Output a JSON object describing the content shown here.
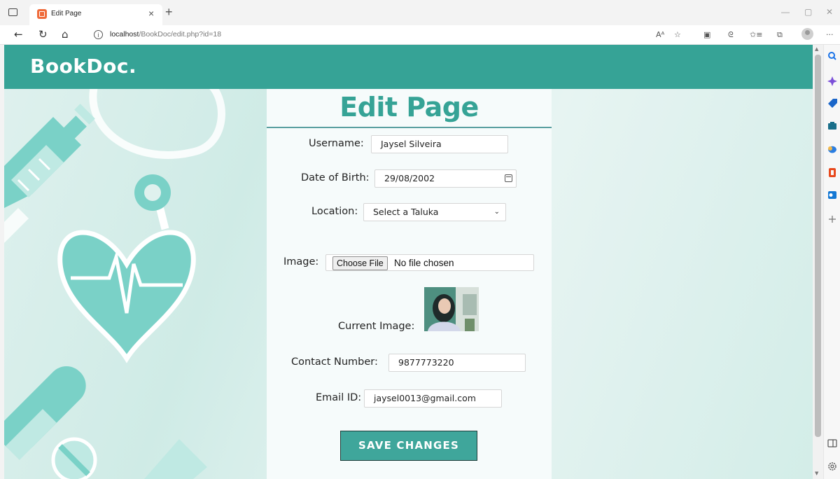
{
  "browser": {
    "tab_title": "Edit Page",
    "tab_close": "×",
    "new_tab": "+",
    "window_controls": {
      "minimize": "—",
      "restore": "▢",
      "close": "✕"
    },
    "url_host": "localhost",
    "url_path": "/BookDoc/edit.php?id=18",
    "nav": {
      "back": "←",
      "reload": "↻",
      "home": "⌂"
    },
    "toolbar_icons": [
      "read-aloud-icon",
      "favorite-add-icon",
      "extensions-icon",
      "refresh-icon",
      "favorites-icon",
      "collections-icon",
      "profile-icon",
      "more-icon"
    ],
    "toolbar_glyphs": {
      "read_aloud": "Aᴬ",
      "favorite_add": "☆",
      "extensions": "▣",
      "copilot": "ᘓ",
      "favorites": "✩≡",
      "collections": "⧉",
      "more": "···"
    }
  },
  "site": {
    "brand": "BookDoc."
  },
  "form": {
    "title": "Edit Page",
    "username": {
      "label": "Username:",
      "value": "Jaysel Silveira"
    },
    "dob": {
      "label": "Date of Birth:",
      "value": "29/08/2002"
    },
    "location": {
      "label": "Location:",
      "selected": "Select a Taluka"
    },
    "image": {
      "label": "Image:",
      "button": "Choose File",
      "status": "No file chosen"
    },
    "current_image": {
      "label": "Current Image:"
    },
    "contact": {
      "label": "Contact Number:",
      "value": "9877773220"
    },
    "email": {
      "label": "Email ID:",
      "value": "jaysel0013@gmail.com"
    },
    "submit": "SAVE CHANGES"
  },
  "colors": {
    "accent": "#36a396",
    "button": "#3fa69b",
    "title_rule": "#5a9fa0"
  },
  "sidebar_icons": [
    "search-icon",
    "copilot-icon",
    "shopping-tag-icon",
    "tools-icon",
    "games-icon",
    "office-icon",
    "outlook-icon",
    "add-icon",
    "sidebar-toggle-icon",
    "settings-icon"
  ]
}
